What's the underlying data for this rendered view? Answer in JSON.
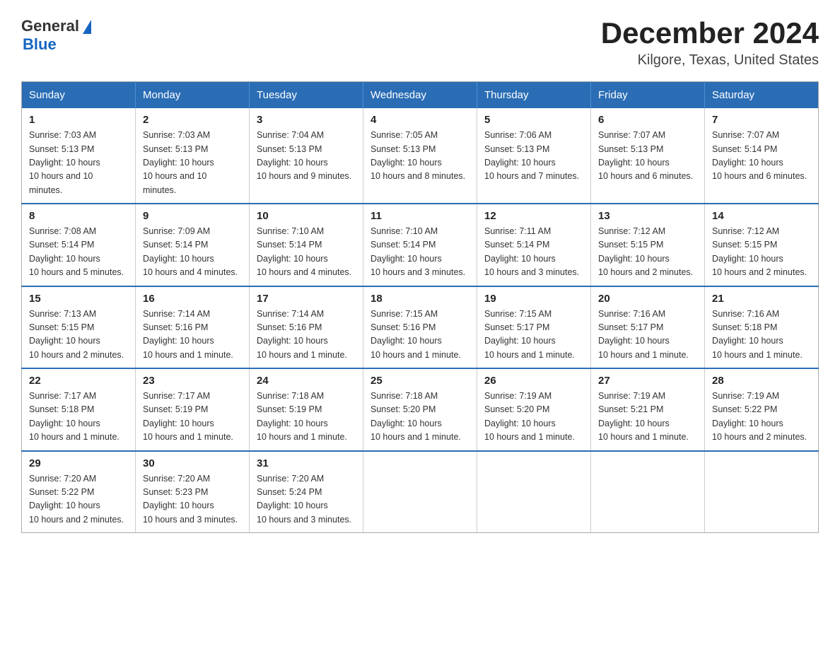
{
  "logo": {
    "general": "General",
    "blue": "Blue"
  },
  "title": "December 2024",
  "subtitle": "Kilgore, Texas, United States",
  "days_of_week": [
    "Sunday",
    "Monday",
    "Tuesday",
    "Wednesday",
    "Thursday",
    "Friday",
    "Saturday"
  ],
  "weeks": [
    [
      {
        "day": "1",
        "sunrise": "7:03 AM",
        "sunset": "5:13 PM",
        "daylight": "10 hours and 10 minutes."
      },
      {
        "day": "2",
        "sunrise": "7:03 AM",
        "sunset": "5:13 PM",
        "daylight": "10 hours and 10 minutes."
      },
      {
        "day": "3",
        "sunrise": "7:04 AM",
        "sunset": "5:13 PM",
        "daylight": "10 hours and 9 minutes."
      },
      {
        "day": "4",
        "sunrise": "7:05 AM",
        "sunset": "5:13 PM",
        "daylight": "10 hours and 8 minutes."
      },
      {
        "day": "5",
        "sunrise": "7:06 AM",
        "sunset": "5:13 PM",
        "daylight": "10 hours and 7 minutes."
      },
      {
        "day": "6",
        "sunrise": "7:07 AM",
        "sunset": "5:13 PM",
        "daylight": "10 hours and 6 minutes."
      },
      {
        "day": "7",
        "sunrise": "7:07 AM",
        "sunset": "5:14 PM",
        "daylight": "10 hours and 6 minutes."
      }
    ],
    [
      {
        "day": "8",
        "sunrise": "7:08 AM",
        "sunset": "5:14 PM",
        "daylight": "10 hours and 5 minutes."
      },
      {
        "day": "9",
        "sunrise": "7:09 AM",
        "sunset": "5:14 PM",
        "daylight": "10 hours and 4 minutes."
      },
      {
        "day": "10",
        "sunrise": "7:10 AM",
        "sunset": "5:14 PM",
        "daylight": "10 hours and 4 minutes."
      },
      {
        "day": "11",
        "sunrise": "7:10 AM",
        "sunset": "5:14 PM",
        "daylight": "10 hours and 3 minutes."
      },
      {
        "day": "12",
        "sunrise": "7:11 AM",
        "sunset": "5:14 PM",
        "daylight": "10 hours and 3 minutes."
      },
      {
        "day": "13",
        "sunrise": "7:12 AM",
        "sunset": "5:15 PM",
        "daylight": "10 hours and 2 minutes."
      },
      {
        "day": "14",
        "sunrise": "7:12 AM",
        "sunset": "5:15 PM",
        "daylight": "10 hours and 2 minutes."
      }
    ],
    [
      {
        "day": "15",
        "sunrise": "7:13 AM",
        "sunset": "5:15 PM",
        "daylight": "10 hours and 2 minutes."
      },
      {
        "day": "16",
        "sunrise": "7:14 AM",
        "sunset": "5:16 PM",
        "daylight": "10 hours and 1 minute."
      },
      {
        "day": "17",
        "sunrise": "7:14 AM",
        "sunset": "5:16 PM",
        "daylight": "10 hours and 1 minute."
      },
      {
        "day": "18",
        "sunrise": "7:15 AM",
        "sunset": "5:16 PM",
        "daylight": "10 hours and 1 minute."
      },
      {
        "day": "19",
        "sunrise": "7:15 AM",
        "sunset": "5:17 PM",
        "daylight": "10 hours and 1 minute."
      },
      {
        "day": "20",
        "sunrise": "7:16 AM",
        "sunset": "5:17 PM",
        "daylight": "10 hours and 1 minute."
      },
      {
        "day": "21",
        "sunrise": "7:16 AM",
        "sunset": "5:18 PM",
        "daylight": "10 hours and 1 minute."
      }
    ],
    [
      {
        "day": "22",
        "sunrise": "7:17 AM",
        "sunset": "5:18 PM",
        "daylight": "10 hours and 1 minute."
      },
      {
        "day": "23",
        "sunrise": "7:17 AM",
        "sunset": "5:19 PM",
        "daylight": "10 hours and 1 minute."
      },
      {
        "day": "24",
        "sunrise": "7:18 AM",
        "sunset": "5:19 PM",
        "daylight": "10 hours and 1 minute."
      },
      {
        "day": "25",
        "sunrise": "7:18 AM",
        "sunset": "5:20 PM",
        "daylight": "10 hours and 1 minute."
      },
      {
        "day": "26",
        "sunrise": "7:19 AM",
        "sunset": "5:20 PM",
        "daylight": "10 hours and 1 minute."
      },
      {
        "day": "27",
        "sunrise": "7:19 AM",
        "sunset": "5:21 PM",
        "daylight": "10 hours and 1 minute."
      },
      {
        "day": "28",
        "sunrise": "7:19 AM",
        "sunset": "5:22 PM",
        "daylight": "10 hours and 2 minutes."
      }
    ],
    [
      {
        "day": "29",
        "sunrise": "7:20 AM",
        "sunset": "5:22 PM",
        "daylight": "10 hours and 2 minutes."
      },
      {
        "day": "30",
        "sunrise": "7:20 AM",
        "sunset": "5:23 PM",
        "daylight": "10 hours and 3 minutes."
      },
      {
        "day": "31",
        "sunrise": "7:20 AM",
        "sunset": "5:24 PM",
        "daylight": "10 hours and 3 minutes."
      },
      null,
      null,
      null,
      null
    ]
  ]
}
